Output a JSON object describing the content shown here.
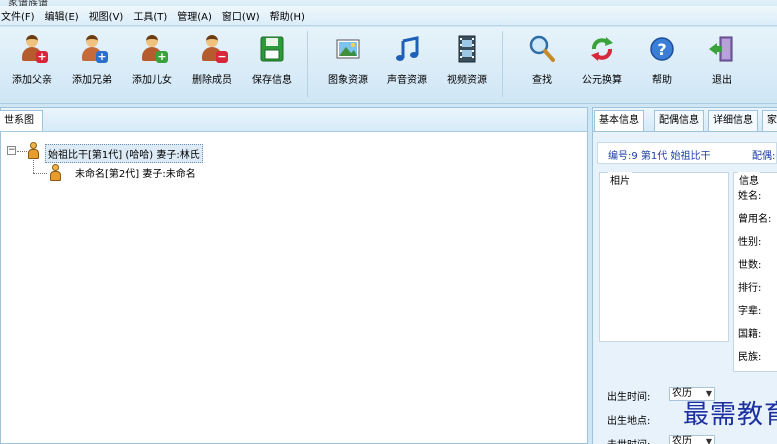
{
  "window": {
    "title": "家谱族谱"
  },
  "menu": [
    "文件(F)",
    "编辑(E)",
    "视图(V)",
    "工具(T)",
    "管理(A)",
    "窗口(W)",
    "帮助(H)"
  ],
  "toolbar": {
    "add_father": "添加父亲",
    "add_brother": "添加兄弟",
    "add_child": "添加儿女",
    "delete_member": "删除成员",
    "save_info": "保存信息",
    "image_res": "图象资源",
    "sound_res": "声音资源",
    "video_res": "视频资源",
    "search": "查找",
    "calendar_convert": "公元换算",
    "help": "帮助",
    "exit": "退出"
  },
  "left_panel": {
    "tab": "世系图",
    "nodes": [
      {
        "text": "始祖比干[第1代] (哈哈) 妻子:林氏"
      },
      {
        "text": "未命名[第2代] 妻子:未命名"
      }
    ]
  },
  "right_panel": {
    "tabs": [
      "基本信息",
      "配偶信息",
      "详细信息",
      "家"
    ],
    "header_id": "编号:9 第1代 始祖比干",
    "header_spouse": "配偶:",
    "photo_label": "相片",
    "info_label": "信息",
    "fields": [
      "姓名:",
      "曾用名:",
      "性别:",
      "世数:",
      "排行:",
      "字辈:",
      "国籍:",
      "民族:"
    ],
    "birth_time_label": "出生时间:",
    "birth_place_label": "出生地点:",
    "death_time_label": "去世时间:",
    "calendar_birth": "农历",
    "calendar_death": "农历"
  },
  "watermark": "最需教育",
  "colors": {
    "accent": "#1a3ea8",
    "panel_bg": "#cfe7f5"
  }
}
